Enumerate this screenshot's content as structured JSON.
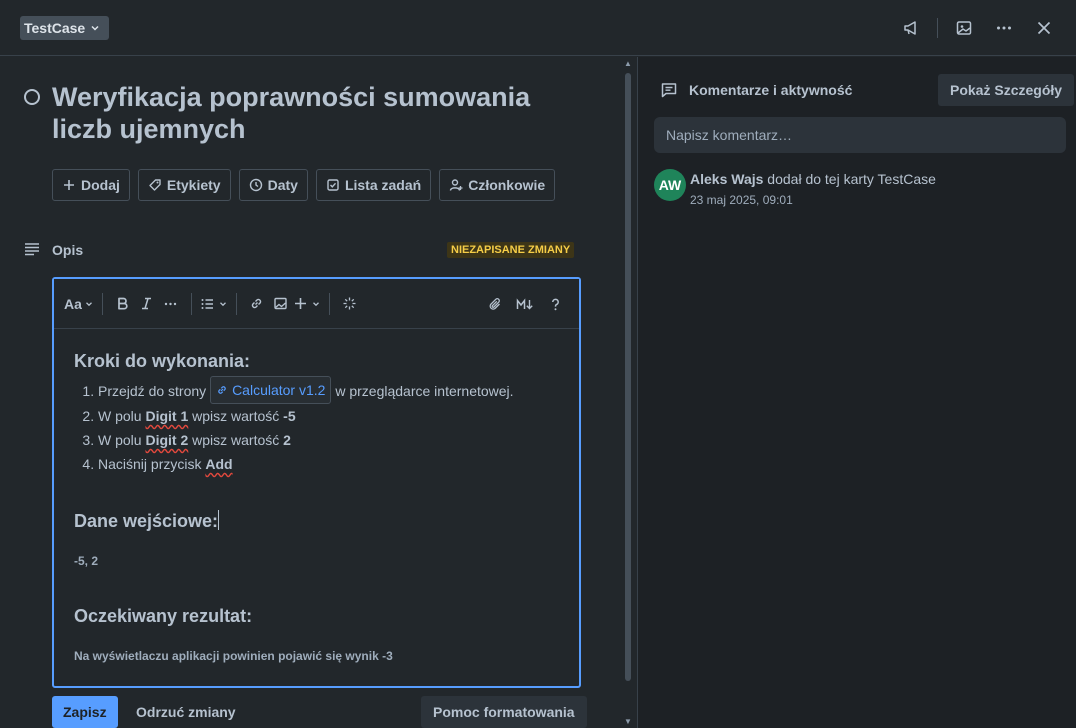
{
  "header": {
    "tag_label": "TestCase"
  },
  "card": {
    "title": "Weryfikacja poprawności sumowania liczb ujemnych",
    "actions": [
      {
        "label": "Dodaj",
        "icon": "plus-icon"
      },
      {
        "label": "Etykiety",
        "icon": "tag-icon"
      },
      {
        "label": "Daty",
        "icon": "clock-icon"
      },
      {
        "label": "Lista zadań",
        "icon": "checklist-icon"
      },
      {
        "label": "Członkowie",
        "icon": "member-icon"
      }
    ]
  },
  "description": {
    "label": "Opis",
    "unsaved_badge": "NIEZAPISANE ZMIANY",
    "toolbar": {
      "text_style": "Aa"
    },
    "steps_heading": "Kroki do wykonania:",
    "steps": {
      "s1_prefix": "Przejdź do strony",
      "s1_link": "Calculator v1.2",
      "s1_suffix": "w przeglądarce internetowej.",
      "s2_prefix": "W polu",
      "s2_field": "Digit 1",
      "s2_mid": "wpisz wartość",
      "s2_value": "-5",
      "s3_prefix": "W polu",
      "s3_field": "Digit 2",
      "s3_mid": "wpisz wartość",
      "s3_value": "2",
      "s4_prefix": "Naciśnij przycisk",
      "s4_button": "Add"
    },
    "input_heading": "Dane wejściowe:",
    "input_value": "-5, 2",
    "expected_heading": "Oczekiwany rezultat:",
    "expected_value": "Na wyświetlaczu aplikacji powinien pojawić się wynik -3"
  },
  "footer": {
    "save": "Zapisz",
    "discard": "Odrzuć zmiany",
    "format_help": "Pomoc formatowania"
  },
  "activity": {
    "title": "Komentarze i aktywność",
    "details_button": "Pokaż Szczegóły",
    "comment_placeholder": "Napisz komentarz…",
    "entry": {
      "avatar_initials": "AW",
      "author": "Aleks Wajs",
      "action": "dodał do tej karty TestCase",
      "timestamp": "23 maj 2025, 09:01"
    }
  },
  "colors": {
    "accent": "#579dff",
    "unsaved": "#f5cd47",
    "avatar": "#1f845a"
  }
}
